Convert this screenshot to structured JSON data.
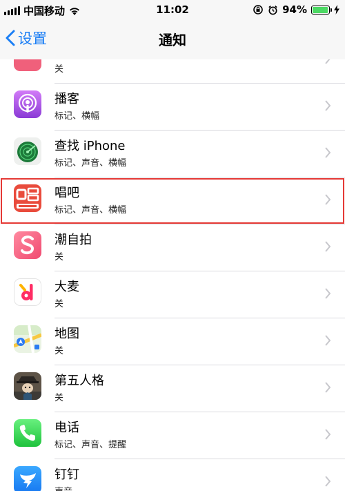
{
  "status_bar": {
    "carrier": "中国移动",
    "time": "11:02",
    "battery": "94%",
    "battery_level": 0.94
  },
  "nav": {
    "back_label": "设置",
    "title": "通知"
  },
  "list": {
    "partial_item_status": "关",
    "items": [
      {
        "name": "播客",
        "status": "标记、横幅",
        "icon": "podcasts-icon",
        "color": "#b150e2"
      },
      {
        "name": "查找 iPhone",
        "status": "标记、声音、横幅",
        "icon": "find-iphone-icon",
        "color": "#3cc35a"
      },
      {
        "name": "唱吧",
        "status": "标记、声音、横幅",
        "icon": "changba-icon",
        "color": "#e94b3c"
      },
      {
        "name": "潮自拍",
        "status": "关",
        "icon": "chaozipai-icon",
        "color": "#f5577a"
      },
      {
        "name": "大麦",
        "status": "关",
        "icon": "damai-icon",
        "color": "#ff2d64"
      },
      {
        "name": "地图",
        "status": "关",
        "icon": "maps-icon",
        "color": "#4a90e2"
      },
      {
        "name": "第五人格",
        "status": "关",
        "icon": "identity-v-icon",
        "color": "#6b5a48"
      },
      {
        "name": "电话",
        "status": "标记、声音、提醒",
        "icon": "phone-icon",
        "color": "#4cd964"
      },
      {
        "name": "钉钉",
        "status": "声音",
        "icon": "dingtalk-icon",
        "color": "#1d8cf8"
      }
    ]
  }
}
